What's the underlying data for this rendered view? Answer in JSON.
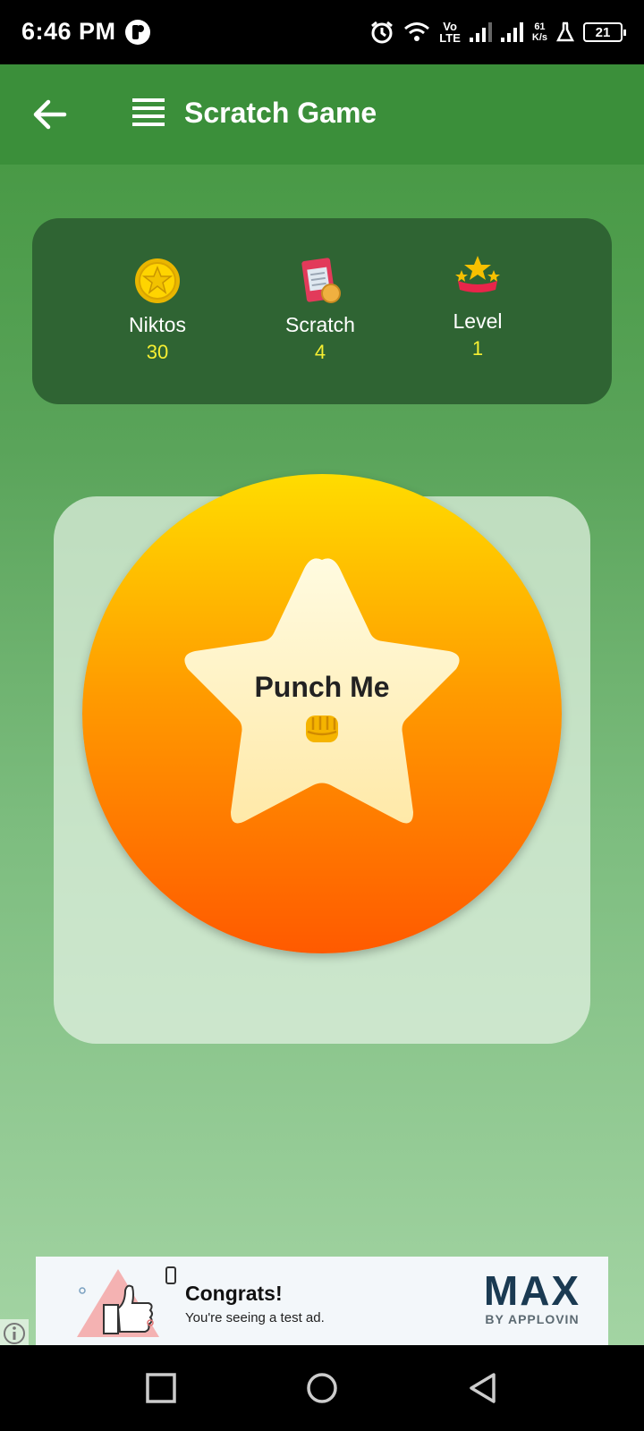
{
  "status_bar": {
    "time": "6:46 PM",
    "network_top": "Vo",
    "network_bottom": "LTE",
    "speed_value": "61",
    "speed_unit": "K/s",
    "battery": "21"
  },
  "app_bar": {
    "title": "Scratch Game",
    "back_icon": "arrow-left-icon",
    "menu_icon": "menu-list-icon"
  },
  "stats": [
    {
      "label": "Niktos",
      "value": "30",
      "icon": "gold-coin-icon"
    },
    {
      "label": "Scratch",
      "value": "4",
      "icon": "scratch-card-icon"
    },
    {
      "label": "Level",
      "value": "1",
      "icon": "stars-ribbon-icon"
    }
  ],
  "game": {
    "button_label": "Punch Me",
    "button_icon": "fist-emoji-icon"
  },
  "ad": {
    "title": "Congrats!",
    "subtitle": "You're seeing a test ad.",
    "brand": "MAX",
    "brand_sub": "BY APPLOVIN"
  },
  "colors": {
    "app_bar": "#3b8f3a",
    "stats_card": "#2f6433",
    "stat_value": "#f6ef32",
    "circle_top": "#ffdc00",
    "circle_bottom": "#ff5a00",
    "star_fill": "#fff4c4"
  }
}
